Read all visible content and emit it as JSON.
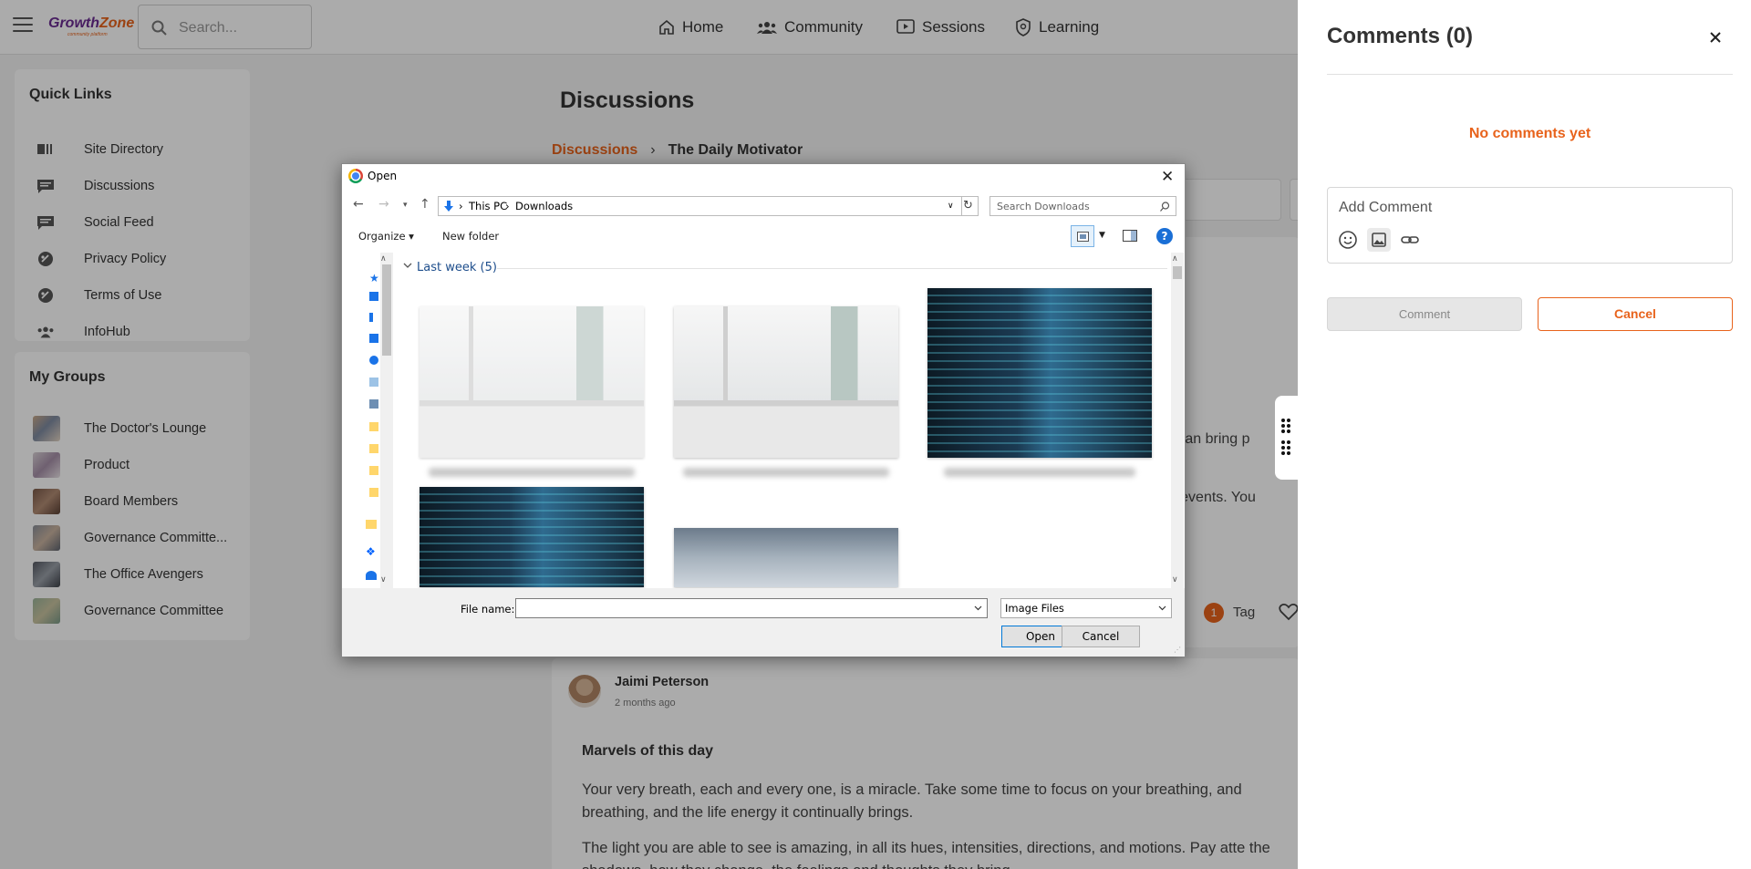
{
  "header": {
    "logo_main": "Growth",
    "logo_accent": "Zone",
    "logo_sub": "community platform",
    "search_placeholder": "Search...",
    "nav": [
      "Home",
      "Community",
      "Sessions",
      "Learning"
    ]
  },
  "quick_links": {
    "title": "Quick Links",
    "items": [
      "Site Directory",
      "Discussions",
      "Social Feed",
      "Privacy Policy",
      "Terms of Use",
      "InfoHub"
    ]
  },
  "my_groups": {
    "title": "My Groups",
    "items": [
      "The Doctor's Lounge",
      "Product",
      "Board Members",
      "Governance Committe...",
      "The Office Avengers",
      "Governance Committee"
    ]
  },
  "main": {
    "heading": "Discussions",
    "breadcrumb": [
      "Discussions",
      "The Daily Motivator"
    ],
    "post1_fragment_1": "n can bring p",
    "post1_fragment_2": "ned events. You",
    "tag_count": "1",
    "tag_label": "Tag",
    "post2": {
      "author": "Jaimi Peterson",
      "time_ago": "2 months ago",
      "title": "Marvels of this day",
      "paragraph_1": "Your very breath, each and every one, is a miracle. Take some time to focus on your breathing, and breathing, and the life energy it continually brings.",
      "paragraph_2": "The light you are able to see is amazing, in all its hues, intensities, directions, and motions. Pay atte the shadows, how they change, the feelings and thoughts they bring."
    }
  },
  "comments_drawer": {
    "title": "Comments (0)",
    "empty_text": "No comments yet",
    "input_placeholder": "Add Comment",
    "comment_button": "Comment",
    "cancel_button": "Cancel"
  },
  "file_dialog": {
    "title": "Open",
    "path": [
      "This PC",
      "Downloads"
    ],
    "search_placeholder": "Search Downloads",
    "organize_label": "Organize",
    "new_folder_label": "New folder",
    "group_header": "Last week (5)",
    "file_name_label": "File name:",
    "file_name_value": "",
    "file_type": "Image Files",
    "open_button": "Open",
    "cancel_button": "Cancel"
  },
  "colors": {
    "accent": "#e8631c",
    "brand": "#6a2c91",
    "dialog_link": "#1e4e8c"
  }
}
